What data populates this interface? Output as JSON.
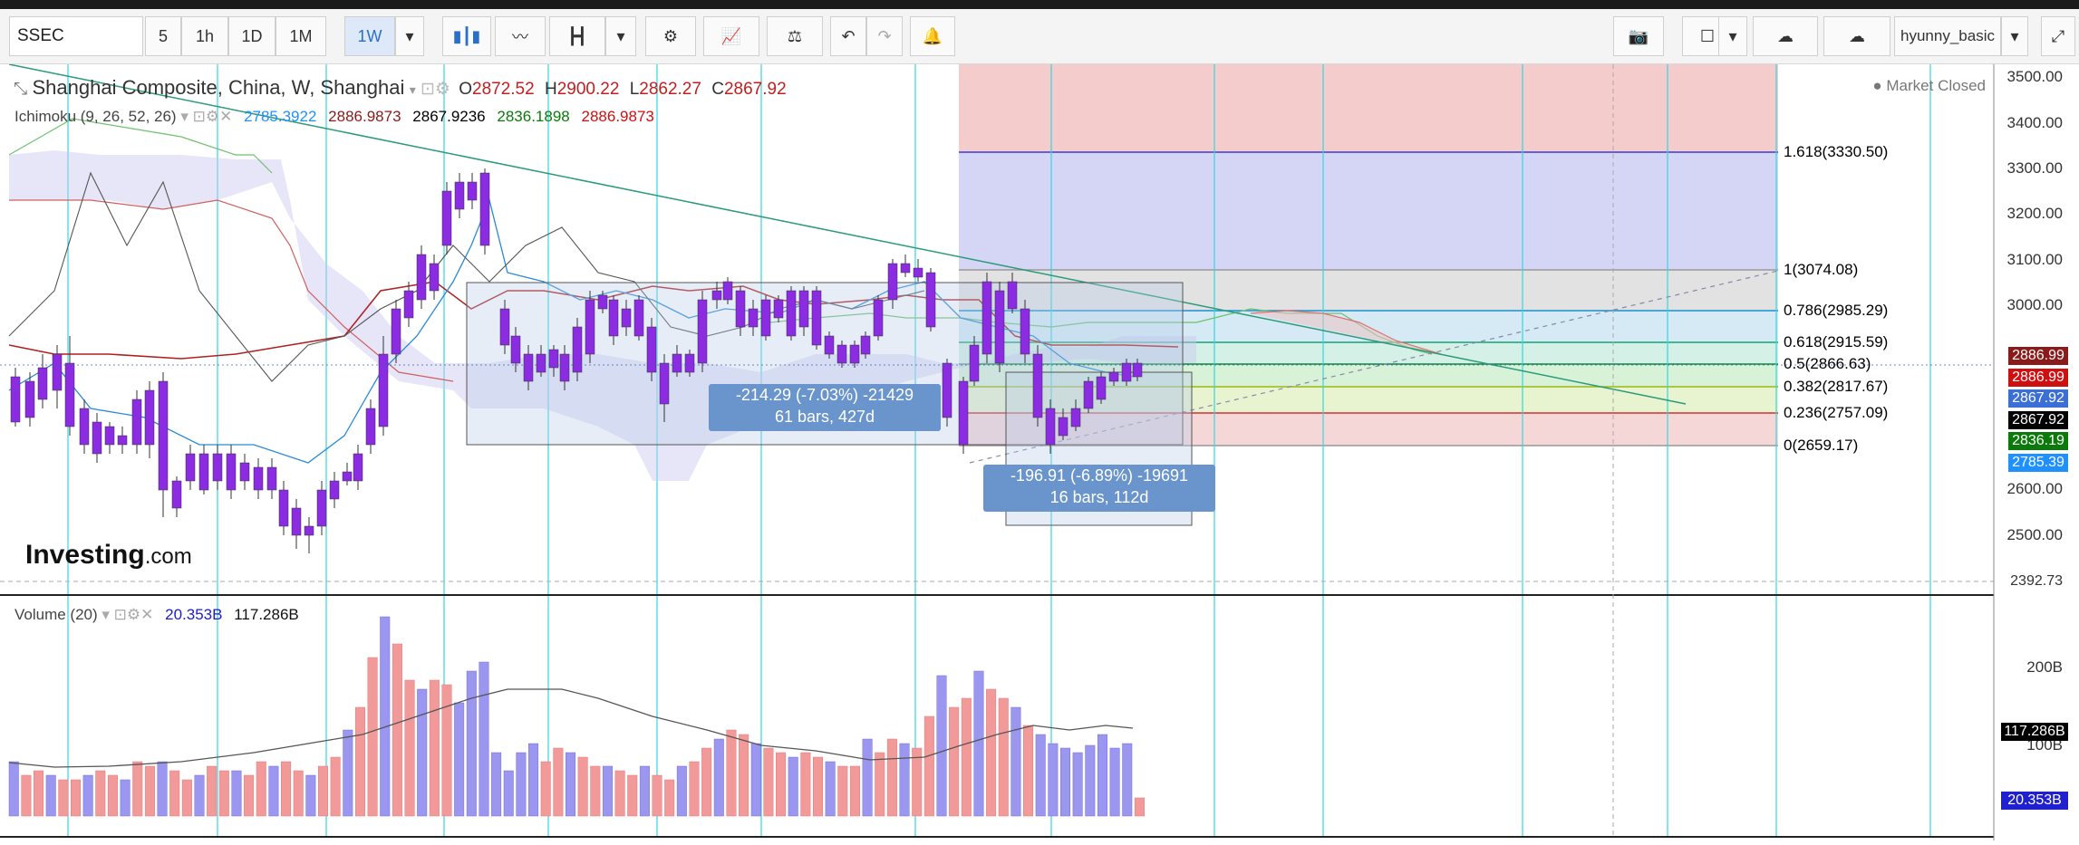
{
  "toolbar": {
    "symbol": "SSEC",
    "intervals": [
      "5",
      "1h",
      "1D",
      "1M",
      "1W"
    ],
    "active_interval": "1W",
    "username": "hyunny_basic",
    "icons": [
      "candle-style-icon",
      "line-chart-icon",
      "bars-icon",
      "settings-icon",
      "indicators-icon",
      "compare-icon",
      "undo-icon",
      "redo-icon",
      "alert-icon",
      "camera-icon",
      "layout-icon",
      "cloud-down-icon",
      "cloud-up-icon",
      "fullscreen-icon"
    ]
  },
  "legend": {
    "title": "Shanghai Composite, China, W, Shanghai",
    "o_label": "O",
    "o": "2872.52",
    "h_label": "H",
    "h": "2900.22",
    "l_label": "L",
    "l": "2862.27",
    "c_label": "C",
    "c": "2867.92",
    "market_status": "Market Closed"
  },
  "ichimoku": {
    "label": "Ichimoku (9, 26, 52, 26)",
    "v1": "2785.3922",
    "v2": "2886.9873",
    "v3": "2867.9236",
    "v4": "2836.1898",
    "v5": "2886.9873",
    "colors": [
      "#1e90ff",
      "#8b1a1a",
      "#000000",
      "#0a7a0a",
      "#d01010"
    ]
  },
  "volume": {
    "label": "Volume (20)",
    "v1": "20.353B",
    "v2": "117.286B",
    "axis": [
      "200B",
      "100B"
    ],
    "last_box": "20.353B",
    "ma_box": "117.286B"
  },
  "price_axis": [
    "3500.00",
    "3400.00",
    "3300.00",
    "3200.00",
    "3100.00",
    "3000.00",
    "2600.00",
    "2500.00"
  ],
  "price_axis_bottom": "2392.73",
  "price_boxes": [
    {
      "text": "2886.99",
      "color": "#8b1a1a"
    },
    {
      "text": "2886.99",
      "color": "#d01010"
    },
    {
      "text": "2867.92",
      "color": "#3b6fd6"
    },
    {
      "text": "2867.92",
      "color": "#000000"
    },
    {
      "text": "2836.19",
      "color": "#0a7a0a"
    },
    {
      "text": "2785.39",
      "color": "#1e90ff"
    }
  ],
  "fib": [
    {
      "label": "1.618(3330.50)",
      "color": "#3b3bd0"
    },
    {
      "label": "1(3074.08)",
      "color": "#555555"
    },
    {
      "label": "0.786(2985.29)",
      "color": "#1a8fd0"
    },
    {
      "label": "0.618(2915.59)",
      "color": "#13a673"
    },
    {
      "label": "0.5(2866.63)",
      "color": "#0a8a3a"
    },
    {
      "label": "0.382(2817.67)",
      "color": "#9ab810"
    },
    {
      "label": "0.236(2757.09)",
      "color": "#d23030"
    },
    {
      "label": "0(2659.17)",
      "color": "#555555"
    }
  ],
  "measure1": {
    "line1": "-214.29 (-7.03%) -21429",
    "line2": "61 bars, 427d"
  },
  "measure2": {
    "line1": "-196.91 (-6.89%) -19691",
    "line2": "16 bars, 112d"
  },
  "watermark": {
    "brand": "Investing",
    "suffix": ".com"
  }
}
